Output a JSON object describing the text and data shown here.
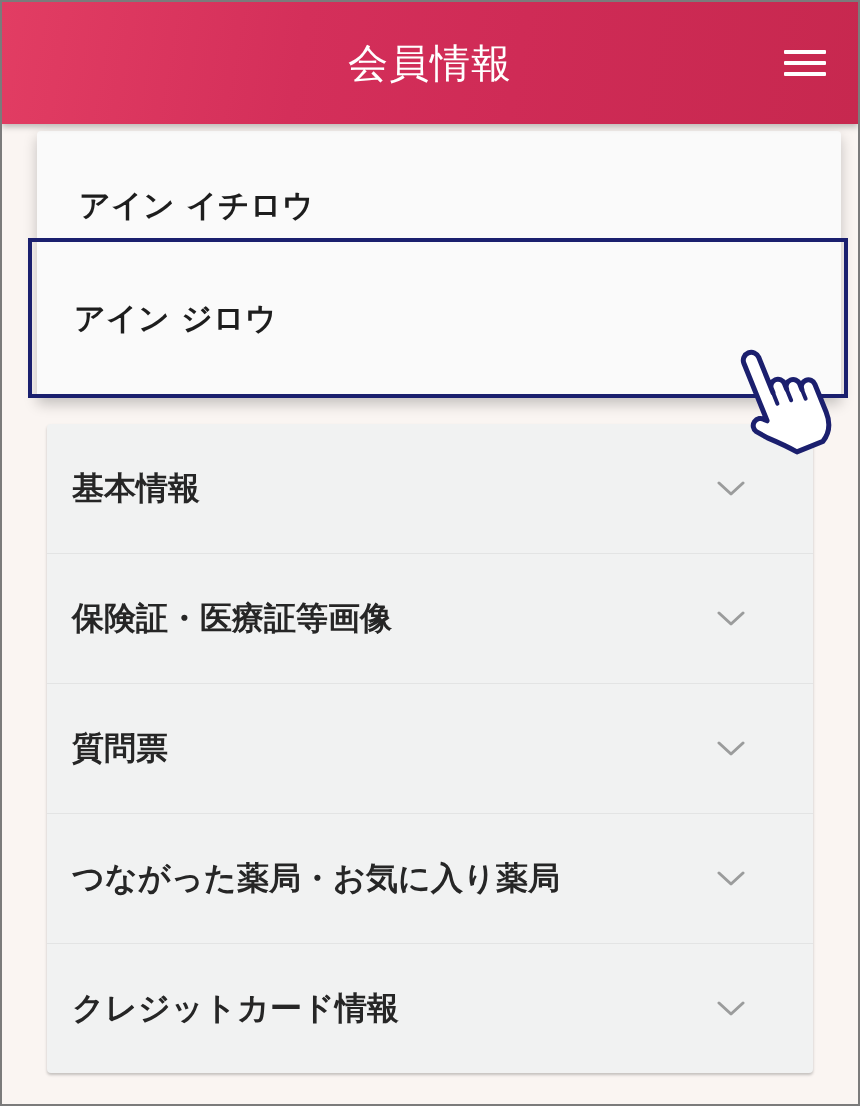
{
  "header": {
    "title": "会員情報"
  },
  "member_dropdown": {
    "options": [
      {
        "label": "アイン イチロウ",
        "selected": false
      },
      {
        "label": "アイン ジロウ",
        "selected": true
      }
    ]
  },
  "sections": [
    {
      "label": "基本情報",
      "expanded": false
    },
    {
      "label": "保険証・医療証等画像",
      "expanded": false
    },
    {
      "label": "質問票",
      "expanded": false
    },
    {
      "label": "つながった薬局・お気に入り薬局",
      "expanded": false
    },
    {
      "label": "クレジットカード情報",
      "expanded": false
    }
  ]
}
